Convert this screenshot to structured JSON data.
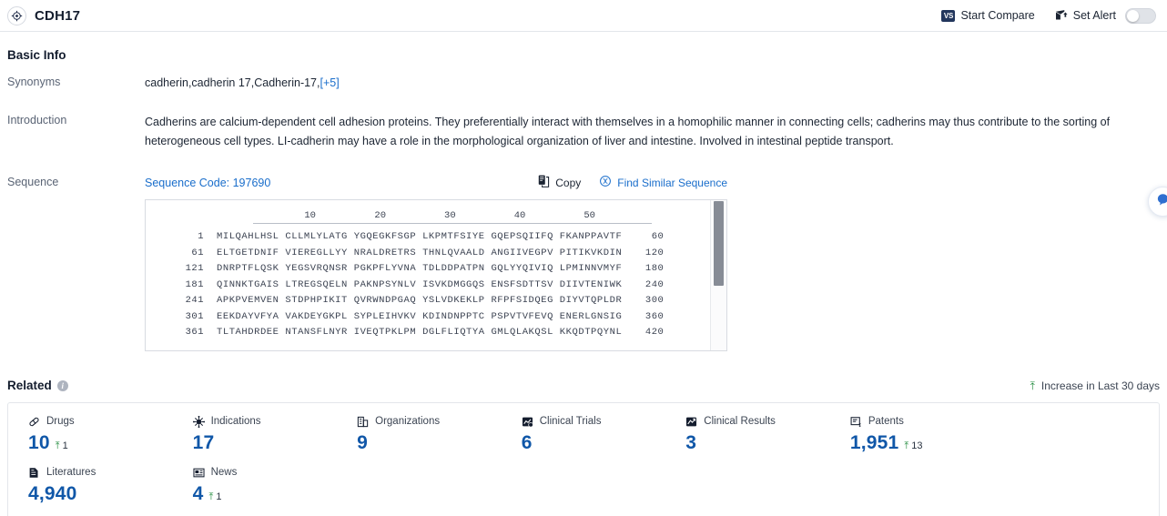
{
  "topbar": {
    "brand_icon": "target-icon",
    "title": "CDH17",
    "start_compare_label": "Start Compare",
    "compare_icon_text": "VS",
    "set_alert_label": "Set Alert",
    "alert_icon": "alert-mail-icon",
    "alert_toggle_state": "off"
  },
  "basic_info": {
    "heading": "Basic Info",
    "synonyms_label": "Synonyms",
    "synonyms_value": "cadherin,cadherin 17,Cadherin-17,",
    "synonyms_more": "[+5]",
    "introduction_label": "Introduction",
    "introduction_value": "Cadherins are calcium-dependent cell adhesion proteins. They preferentially interact with themselves in a homophilic manner in connecting cells; cadherins may thus contribute to the sorting of heterogeneous cell types. LI-cadherin may have a role in the morphological organization of liver and intestine. Involved in intestinal peptide transport.",
    "sequence_label": "Sequence",
    "sequence_code_label": "Sequence Code: 197690",
    "copy_label": "Copy",
    "copy_icon": "copy-icon",
    "find_similar_label": "Find Similar Sequence",
    "find_similar_icon": "find-similar-icon"
  },
  "sequence": {
    "ruler_ticks": [
      "10",
      "20",
      "30",
      "40",
      "50"
    ],
    "lines": [
      {
        "start": "1",
        "residues": "MILQAHLHSL CLLMLYLATG YGQEGKFSGP LKPMTFSIYE GQEPSQIIFQ FKANPPAVTF",
        "end": "60"
      },
      {
        "start": "61",
        "residues": "ELTGETDNIF VIEREGLLYY NRALDRETRS THNLQVAALD ANGIIVEGPV PITIKVKDIN",
        "end": "120"
      },
      {
        "start": "121",
        "residues": "DNRPTFLQSK YEGSVRQNSR PGKPFLYVNA TDLDDPATPN GQLYYQIVIQ LPMINNVMYF",
        "end": "180"
      },
      {
        "start": "181",
        "residues": "QINNKTGAIS LTREGSQELN PAKNPSYNLV ISVKDMGGQS ENSFSDTTSV DIIVTENIWK",
        "end": "240"
      },
      {
        "start": "241",
        "residues": "APKPVEMVEN STDPHPIKIT QVRWNDPGAQ YSLVDKEKLP RFPFSIDQEG DIYVTQPLDR",
        "end": "300"
      },
      {
        "start": "301",
        "residues": "EEKDAYVFYA VAKDEYGKPL SYPLEIHVKV KDINDNPPTC PSPVTVFEVQ ENERLGNSIG",
        "end": "360"
      },
      {
        "start": "361",
        "residues": "TLTAHDRDEE NTANSFLNYR IVEQTPKLPM DGLFLIQTYA GMLQLAKQSL KKQDTPQYNL",
        "end": "420"
      }
    ]
  },
  "related": {
    "heading": "Related",
    "info_icon": "info-icon",
    "increase_note": "Increase in Last 30 days",
    "increase_icon": "up-arrow-icon",
    "stats": [
      {
        "label": "Drugs",
        "icon": "pill-icon",
        "value": "10",
        "delta": "1"
      },
      {
        "label": "Indications",
        "icon": "virus-icon",
        "value": "17",
        "delta": ""
      },
      {
        "label": "Organizations",
        "icon": "building-icon",
        "value": "9",
        "delta": ""
      },
      {
        "label": "Clinical Trials",
        "icon": "clinical-trial-icon",
        "value": "6",
        "delta": ""
      },
      {
        "label": "Clinical Results",
        "icon": "clinical-result-icon",
        "value": "3",
        "delta": ""
      },
      {
        "label": "Patents",
        "icon": "patent-icon",
        "value": "1,951",
        "delta": "13"
      },
      {
        "label": "Literatures",
        "icon": "literature-icon",
        "value": "4,940",
        "delta": ""
      },
      {
        "label": "News",
        "icon": "news-icon",
        "value": "4",
        "delta": "1"
      }
    ]
  },
  "side_fab": {
    "icon": "assistant-icon"
  },
  "colors": {
    "accent_blue": "#1057a8",
    "link_blue": "#1a6ecb",
    "up_green": "#1f8a3b",
    "border": "#e3e6eb",
    "text": "#1c2533",
    "muted": "#5a6475"
  }
}
